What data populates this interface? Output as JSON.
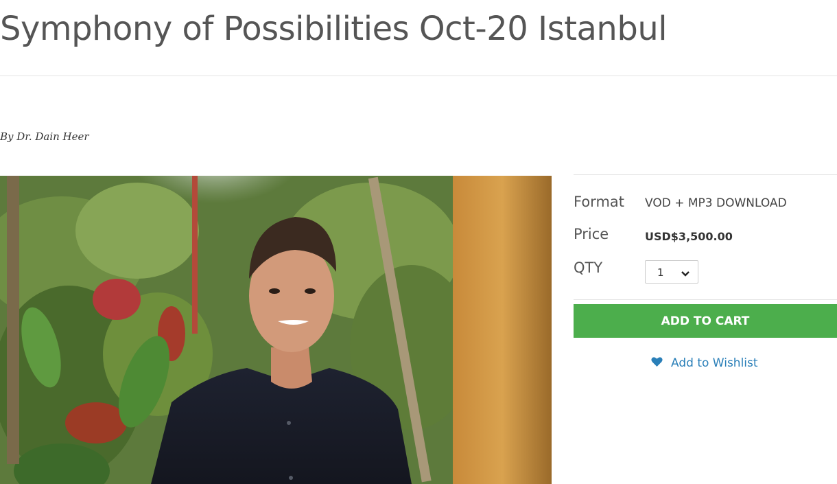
{
  "product": {
    "title": "Symphony of Possibilities Oct-20 Istanbul",
    "byline": "By Dr. Dain Heer"
  },
  "details": {
    "format_label": "Format",
    "format_value": "VOD + MP3 DOWNLOAD",
    "price_label": "Price",
    "price_value": "USD$3,500.00",
    "qty_label": "QTY",
    "qty_value": "1"
  },
  "actions": {
    "add_to_cart": "ADD TO CART",
    "add_to_wishlist": "Add to Wishlist"
  },
  "icons": {
    "wishlist": "heart-icon",
    "qty_dropdown": "chevron-down-icon"
  },
  "colors": {
    "title": "#555555",
    "add_to_cart_bg": "#4cae4c",
    "link": "#2a7fb8"
  }
}
